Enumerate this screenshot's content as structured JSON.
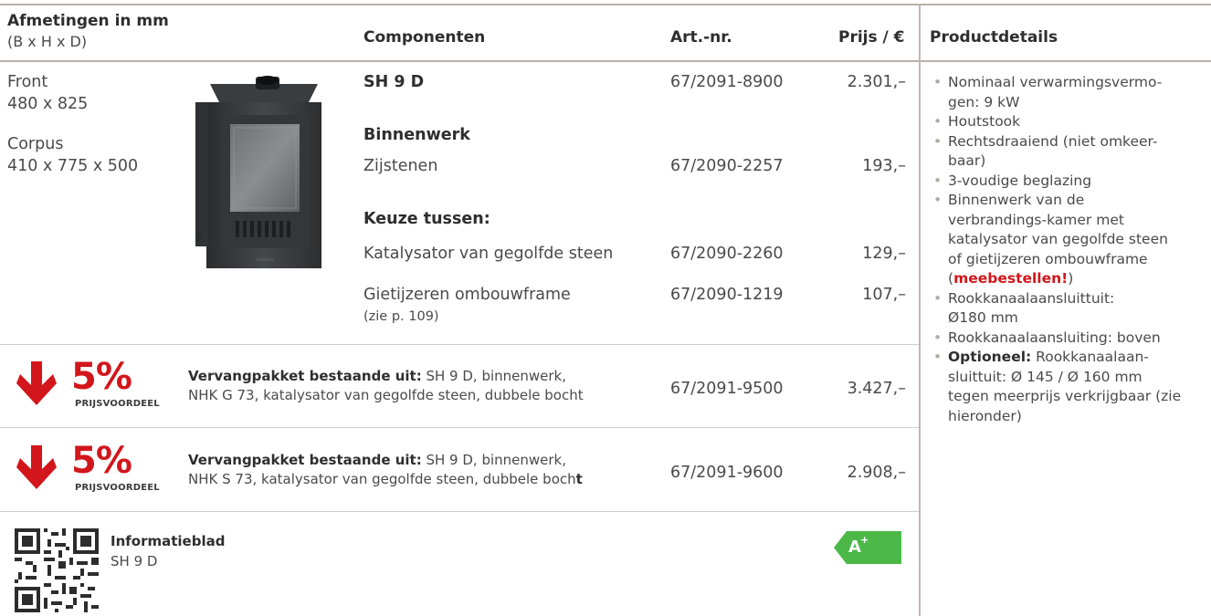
{
  "table": {
    "headers": {
      "dimensions": "Afmetingen in mm",
      "dimensions_sub": "(B x H x D)",
      "components": "Componenten",
      "artnr": "Art.-nr.",
      "price": "Prijs / €",
      "details": "Productdetails"
    },
    "dimensions": {
      "front_label": "Front",
      "front_value": "480 x 825",
      "corpus_label": "Corpus",
      "corpus_value": "410 x 775 x 500"
    },
    "rows": [
      {
        "component": "SH 9 D",
        "artnr": "67/2091-8900",
        "price": "2.301,–"
      },
      {
        "section": "Binnenwerk"
      },
      {
        "component": "Zijstenen",
        "artnr": "67/2090-2257",
        "price": "193,–"
      },
      {
        "section": "Keuze tussen:"
      },
      {
        "component": "Katalysator van gegolfde steen",
        "artnr": "67/2090-2260",
        "price": "129,–"
      },
      {
        "component": "Gietijzeren ombouwframe",
        "note": "(zie p. 109)",
        "artnr": "67/2090-1219",
        "price": "107,–"
      }
    ]
  },
  "packages": [
    {
      "discount": "5%",
      "discount_label": "PRIJSVOORDEEL",
      "title": "Vervangpakket bestaande uit:",
      "line1": " SH 9 D, binnenwerk,",
      "line2": "NHK G 73, katalysator van gegolfde steen, dubbele bocht",
      "artnr": "67/2091-9500",
      "price": "3.427,–"
    },
    {
      "discount": "5%",
      "discount_label": "PRIJSVOORDEEL",
      "title": "Vervangpakket bestaande uit:",
      "line1": " SH 9 D, binnenwerk,",
      "line2": "NHK S 73, katalysator van gegolfde steen, dubbele boch",
      "line2_bold_tail": "t",
      "artnr": "67/2091-9600",
      "price": "2.908,–"
    }
  ],
  "info": {
    "title": "Informatieblad",
    "subtitle": "SH 9 D",
    "energy_class": "A",
    "energy_sup": "+"
  },
  "details": {
    "items": [
      {
        "text": "Nominaal verwarmingsvermo-\ngen: 9 kW"
      },
      {
        "text": "Houtstook"
      },
      {
        "text": "Rechtsdraaiend (niet omkeer-\nbaar)"
      },
      {
        "text": "3-voudige beglazing"
      },
      {
        "text": "Binnenwerk van de\nverbrandings-kamer met\nkatalysator van gegolfde steen\nof gietijzeren ombouwframe"
      },
      {
        "pre": "(",
        "emph": "meebestellen!",
        "post": ")"
      },
      {
        "text": "Rookkanaalaansluittuit:\nØ180 mm"
      },
      {
        "text": "Rookkanaalaansluiting: boven"
      },
      {
        "bold": "Optioneel:",
        "text": " Rookkanaalaan-\nsluittuit: Ø 145 / Ø 160 mm\ntegen meerprijs verkrijgbaar (zie\nhieronder)"
      }
    ]
  },
  "colors": {
    "accent_red": "#d2161b",
    "energy_green": "#4cb848",
    "rule": "#bdb7b0"
  }
}
